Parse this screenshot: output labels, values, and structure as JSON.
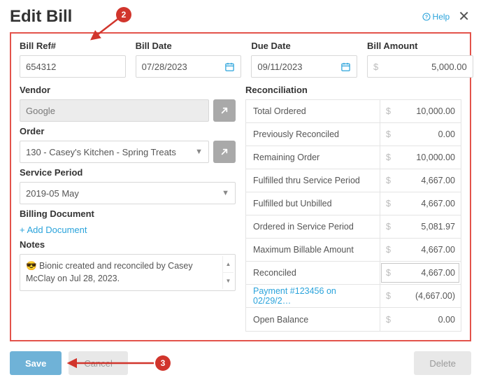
{
  "title": "Edit Bill",
  "help": "Help",
  "fields": {
    "billRefLabel": "Bill Ref#",
    "billRef": "654312",
    "billDateLabel": "Bill Date",
    "billDate": "07/28/2023",
    "dueDateLabel": "Due Date",
    "dueDate": "09/11/2023",
    "billAmountLabel": "Bill Amount",
    "billAmount": "5,000.00",
    "vendorLabel": "Vendor",
    "vendor": "Google",
    "orderLabel": "Order",
    "order": "130 - Casey's Kitchen - Spring Treats",
    "servicePeriodLabel": "Service Period",
    "servicePeriod": "2019-05 May",
    "billingDocLabel": "Billing Document",
    "addDoc": "+ Add Document",
    "notesLabel": "Notes",
    "notesText": "😎 Bionic created and reconciled by Casey McClay on Jul 28, 2023."
  },
  "reconciliation": {
    "title": "Reconciliation",
    "rows": [
      {
        "label": "Total Ordered",
        "value": "10,000.00",
        "link": false,
        "boxed": false
      },
      {
        "label": "Previously Reconciled",
        "value": "0.00",
        "link": false,
        "boxed": false
      },
      {
        "label": "Remaining Order",
        "value": "10,000.00",
        "link": false,
        "boxed": false
      },
      {
        "label": "Fulfilled thru Service Period",
        "value": "4,667.00",
        "link": false,
        "boxed": false
      },
      {
        "label": "Fulfilled but Unbilled",
        "value": "4,667.00",
        "link": false,
        "boxed": false
      },
      {
        "label": "Ordered in Service Period",
        "value": "5,081.97",
        "link": false,
        "boxed": false
      },
      {
        "label": "Maximum Billable Amount",
        "value": "4,667.00",
        "link": false,
        "boxed": false
      },
      {
        "label": "Reconciled",
        "value": "4,667.00",
        "link": false,
        "boxed": true
      },
      {
        "label": "Payment #123456 on 02/29/2…",
        "value": "(4,667.00)",
        "link": true,
        "boxed": false
      },
      {
        "label": "Open Balance",
        "value": "0.00",
        "link": false,
        "boxed": false
      }
    ]
  },
  "buttons": {
    "save": "Save",
    "cancel": "Cancel",
    "delete": "Delete"
  },
  "badges": {
    "b2": "2",
    "b3": "3"
  },
  "currency": "$"
}
